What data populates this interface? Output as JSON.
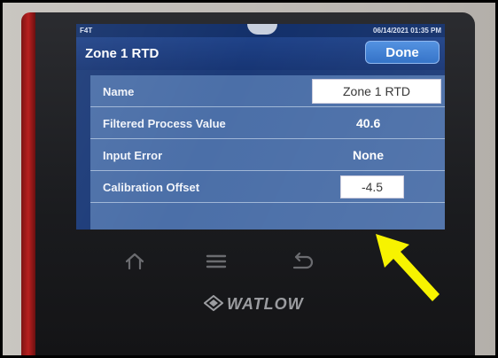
{
  "status": {
    "left_text": "F4T",
    "datetime": "06/14/2021 01:35 PM"
  },
  "header": {
    "title": "Zone 1 RTD",
    "done_label": "Done"
  },
  "rows": [
    {
      "label": "Name",
      "value": "Zone 1 RTD"
    },
    {
      "label": "Filtered Process Value",
      "value": "40.6"
    },
    {
      "label": "Input Error",
      "value": "None"
    },
    {
      "label": "Calibration Offset",
      "value": "-4.5"
    }
  ],
  "nav": {
    "home_icon": "home-icon",
    "menu_icon": "menu-icon",
    "back_icon": "back-icon"
  },
  "brand": {
    "logo_text": "WATLOW"
  },
  "annotation": {
    "arrow_color": "#f7f300"
  },
  "colors": {
    "screen_blue": "#1b3a78",
    "panel_blue": "#4b6fa8",
    "button_blue": "#2f6fc6",
    "device_red": "#b82020"
  }
}
